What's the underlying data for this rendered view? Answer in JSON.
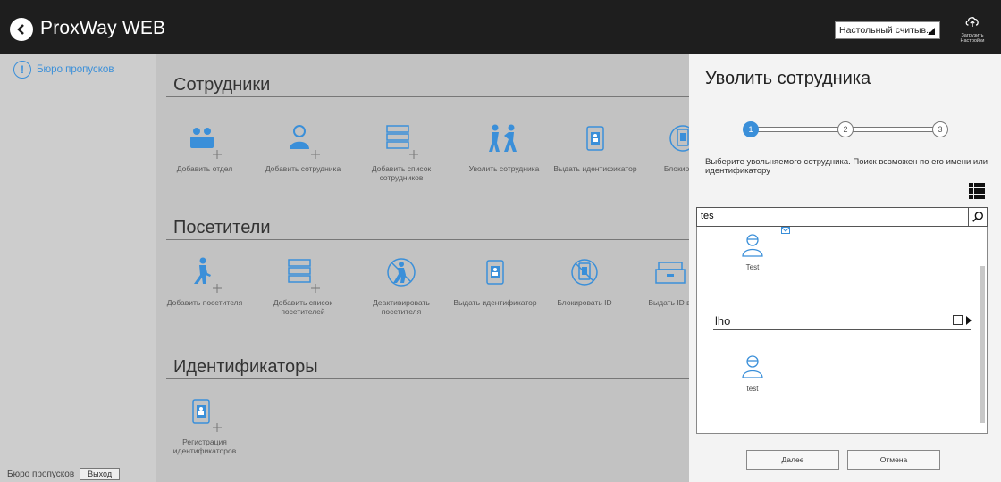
{
  "header": {
    "title": "ProxWay WEB",
    "reader_select": "Настольный считыв...",
    "upload_settings": [
      "Загрузить",
      "Настройки"
    ]
  },
  "sidebar": {
    "item_label": "Бюро пропусков",
    "footer_label": "Бюро пропусков",
    "logout_label": "Выход"
  },
  "sections": {
    "employees": {
      "title": "Сотрудники",
      "tiles": [
        "Добавить отдел",
        "Добавить сотрудника",
        "Добавить список сотрудников",
        "Уволить сотрудника",
        "Выдать идентификатор",
        "Блокирова"
      ]
    },
    "visitors": {
      "title": "Посетители",
      "tiles": [
        "Добавить посетителя",
        "Добавить список посетителей",
        "Деактивировать посетителя",
        "Выдать идентификатор",
        "Блокировать ID",
        "Выдать ID в"
      ]
    },
    "identifiers": {
      "title": "Идентификаторы",
      "tiles": [
        "Регистрация идентификаторов"
      ]
    }
  },
  "panel": {
    "title": "Уволить сотрудника",
    "steps": [
      "1",
      "2",
      "3"
    ],
    "active_step": 1,
    "hint": "Выберите увольняемого сотрудника. Поиск возможен по его имени или идентификатору",
    "search_value": "tes",
    "results": [
      {
        "name": "Test"
      },
      {
        "group": "lho"
      },
      {
        "name": "test"
      }
    ],
    "next_label": "Далее",
    "cancel_label": "Отмена"
  },
  "colors": {
    "accent": "#3a8fd9",
    "topbar": "#1e1e1e",
    "sidebar": "#cdcdcd",
    "main_bg": "#c2c2c2",
    "panel_bg": "#f3f3f3"
  }
}
